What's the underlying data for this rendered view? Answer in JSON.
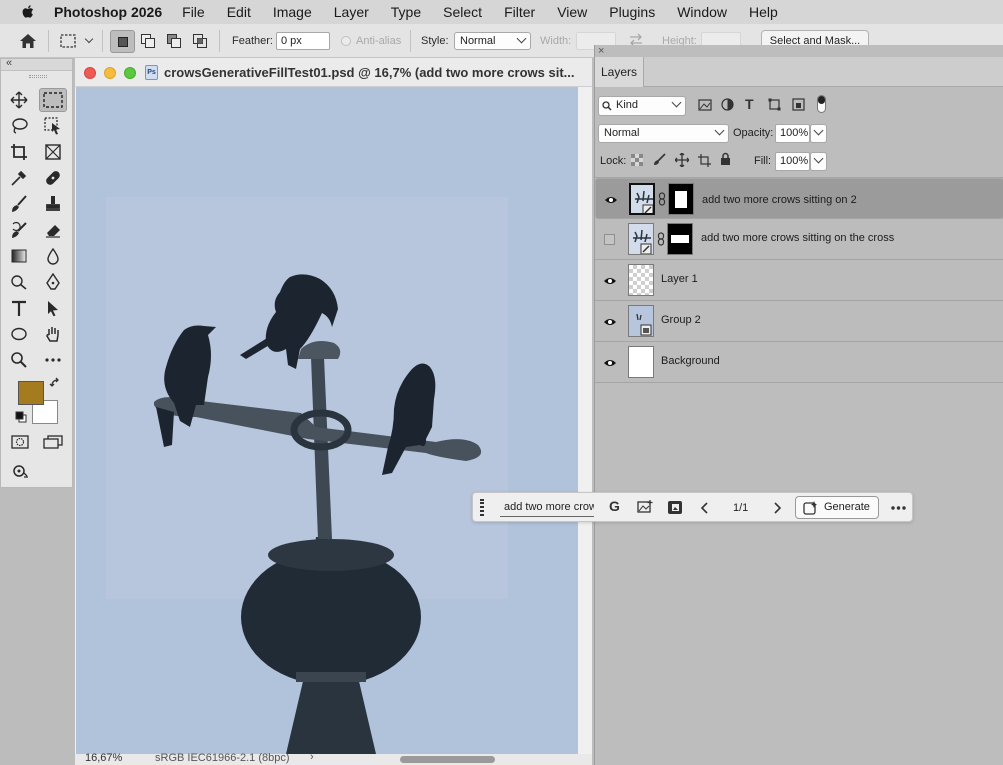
{
  "menubar": {
    "app_name": "Photoshop 2026",
    "items": [
      "File",
      "Edit",
      "Image",
      "Layer",
      "Type",
      "Select",
      "Filter",
      "View",
      "Plugins",
      "Window",
      "Help"
    ]
  },
  "options": {
    "feather_label": "Feather:",
    "feather_value": "0 px",
    "antialias_label": "Anti-alias",
    "style_label": "Style:",
    "style_value": "Normal",
    "width_label": "Width:",
    "height_label": "Height:",
    "select_mask_label": "Select and Mask..."
  },
  "tools": {
    "foreground_color": "#a57b1f",
    "background_color": "#ffffff"
  },
  "document": {
    "title": "crowsGenerativeFillTest01.psd @ 16,7% (add two more crows sit...",
    "zoom": "16,67%",
    "profile": "sRGB IEC61966-2.1 (8bpc)"
  },
  "layers_panel": {
    "tab_label": "Layers",
    "filter_value": "Kind",
    "blend_mode": "Normal",
    "opacity_label": "Opacity:",
    "opacity_value": "100%",
    "lock_label": "Lock:",
    "fill_label": "Fill:",
    "fill_value": "100%",
    "layers": [
      {
        "name": "add two more crows sitting on 2",
        "visible": true,
        "selected": true
      },
      {
        "name": "add two more crows sitting on the cross",
        "visible": false,
        "selected": false
      },
      {
        "name": "Layer 1",
        "visible": true,
        "selected": false
      },
      {
        "name": "Group 2",
        "visible": true,
        "selected": false
      },
      {
        "name": "Background",
        "visible": true,
        "selected": false
      }
    ]
  },
  "generative_bar": {
    "prompt_value": "add two more crows sitting on the cross",
    "page_indicator": "1/1",
    "generate_label": "Generate"
  },
  "colors": {
    "sky": "#b2c3dc",
    "silhouette": "#1f2a36",
    "selected_row": "#9b9b9b"
  }
}
